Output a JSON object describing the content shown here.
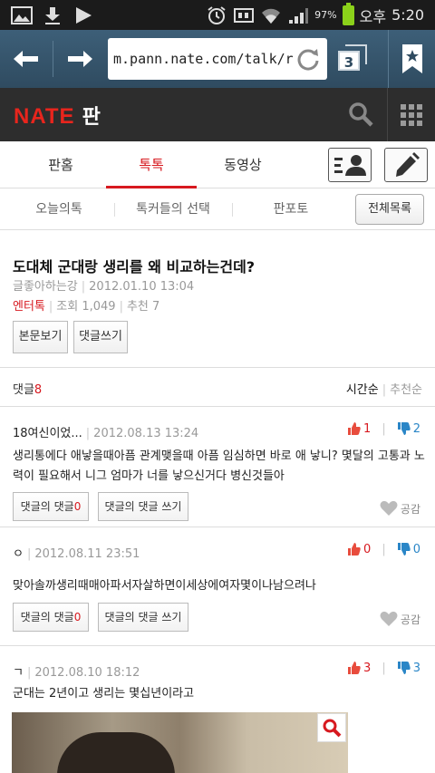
{
  "status_bar": {
    "battery": "97%",
    "ampm": "오후",
    "time": "5:20",
    "battery_color": "#8bd11a"
  },
  "browser": {
    "url": "m.pann.nate.com/talk/r",
    "tab_count": "3"
  },
  "site": {
    "logo_nate": "NATE",
    "logo_pan": "판",
    "brand_color": "#e8251d"
  },
  "main_tabs": [
    {
      "label": "판홈"
    },
    {
      "label": "톡톡",
      "active": true
    },
    {
      "label": "동영상"
    }
  ],
  "sub_tabs": [
    {
      "label": "오늘의톡"
    },
    {
      "label": "톡커들의 선택"
    },
    {
      "label": "판포토"
    }
  ],
  "all_list_label": "전체목록",
  "article": {
    "title": "도대체 군대랑 생리를 왜 비교하는건데?",
    "author": "글좋아하는강",
    "date": "2012.01.10 13:04",
    "category": "엔터톡",
    "views": "조회 1,049",
    "recommend": "추천 7",
    "view_body_label": "본문보기",
    "write_comment_label": "댓글쓰기"
  },
  "comments_header": {
    "label": "댓글",
    "count": "8",
    "sort_time": "시간순",
    "sort_rec": "추천순"
  },
  "comments": [
    {
      "author": "18여신이었...",
      "date": "2012.08.13 13:24",
      "up": "1",
      "down": "2",
      "text": "생리통에다 애낳을때아픔 관계맺을때 아픔 임심하면 바로 애 낳니? 몇달의 고통과 노력이 필요해서 니그 엄마가 너를 낳으신거다 병신것들아",
      "reply_label": "댓글의 댓글",
      "reply_count": "0",
      "reply_write_label": "댓글의 댓글 쓰기",
      "like_label": "공감"
    },
    {
      "author": "ㅇ",
      "date": "2012.08.11 23:51",
      "up": "0",
      "down": "0",
      "text": "맞아솔까생리때매아파서자살하면이세상에여자몇이나남으려나",
      "reply_label": "댓글의 댓글",
      "reply_count": "0",
      "reply_write_label": "댓글의 댓글 쓰기",
      "like_label": "공감"
    },
    {
      "author": "ㄱ",
      "date": "2012.08.10 18:12",
      "up": "3",
      "down": "3",
      "text": "군대는 2년이고 생리는 몇십년이라고"
    }
  ],
  "colors": {
    "accent_red": "#d7191f",
    "vote_blue": "#2a86c7",
    "toolbar": "#3d5f78",
    "header_dark": "#2d2d2d"
  }
}
